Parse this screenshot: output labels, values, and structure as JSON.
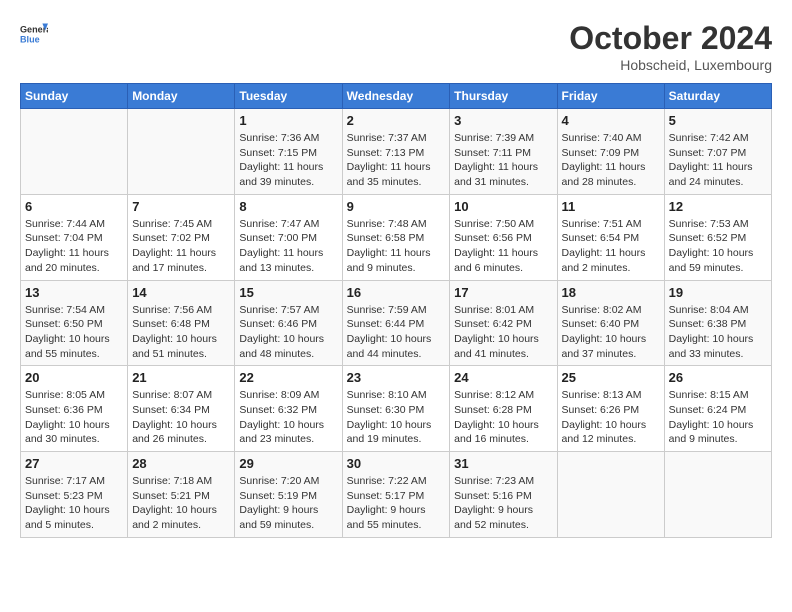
{
  "header": {
    "logo_general": "General",
    "logo_blue": "Blue",
    "month_title": "October 2024",
    "location": "Hobscheid, Luxembourg"
  },
  "days_of_week": [
    "Sunday",
    "Monday",
    "Tuesday",
    "Wednesday",
    "Thursday",
    "Friday",
    "Saturday"
  ],
  "weeks": [
    [
      {
        "day": "",
        "info": ""
      },
      {
        "day": "",
        "info": ""
      },
      {
        "day": "1",
        "info": "Sunrise: 7:36 AM\nSunset: 7:15 PM\nDaylight: 11 hours\nand 39 minutes."
      },
      {
        "day": "2",
        "info": "Sunrise: 7:37 AM\nSunset: 7:13 PM\nDaylight: 11 hours\nand 35 minutes."
      },
      {
        "day": "3",
        "info": "Sunrise: 7:39 AM\nSunset: 7:11 PM\nDaylight: 11 hours\nand 31 minutes."
      },
      {
        "day": "4",
        "info": "Sunrise: 7:40 AM\nSunset: 7:09 PM\nDaylight: 11 hours\nand 28 minutes."
      },
      {
        "day": "5",
        "info": "Sunrise: 7:42 AM\nSunset: 7:07 PM\nDaylight: 11 hours\nand 24 minutes."
      }
    ],
    [
      {
        "day": "6",
        "info": "Sunrise: 7:44 AM\nSunset: 7:04 PM\nDaylight: 11 hours\nand 20 minutes."
      },
      {
        "day": "7",
        "info": "Sunrise: 7:45 AM\nSunset: 7:02 PM\nDaylight: 11 hours\nand 17 minutes."
      },
      {
        "day": "8",
        "info": "Sunrise: 7:47 AM\nSunset: 7:00 PM\nDaylight: 11 hours\nand 13 minutes."
      },
      {
        "day": "9",
        "info": "Sunrise: 7:48 AM\nSunset: 6:58 PM\nDaylight: 11 hours\nand 9 minutes."
      },
      {
        "day": "10",
        "info": "Sunrise: 7:50 AM\nSunset: 6:56 PM\nDaylight: 11 hours\nand 6 minutes."
      },
      {
        "day": "11",
        "info": "Sunrise: 7:51 AM\nSunset: 6:54 PM\nDaylight: 11 hours\nand 2 minutes."
      },
      {
        "day": "12",
        "info": "Sunrise: 7:53 AM\nSunset: 6:52 PM\nDaylight: 10 hours\nand 59 minutes."
      }
    ],
    [
      {
        "day": "13",
        "info": "Sunrise: 7:54 AM\nSunset: 6:50 PM\nDaylight: 10 hours\nand 55 minutes."
      },
      {
        "day": "14",
        "info": "Sunrise: 7:56 AM\nSunset: 6:48 PM\nDaylight: 10 hours\nand 51 minutes."
      },
      {
        "day": "15",
        "info": "Sunrise: 7:57 AM\nSunset: 6:46 PM\nDaylight: 10 hours\nand 48 minutes."
      },
      {
        "day": "16",
        "info": "Sunrise: 7:59 AM\nSunset: 6:44 PM\nDaylight: 10 hours\nand 44 minutes."
      },
      {
        "day": "17",
        "info": "Sunrise: 8:01 AM\nSunset: 6:42 PM\nDaylight: 10 hours\nand 41 minutes."
      },
      {
        "day": "18",
        "info": "Sunrise: 8:02 AM\nSunset: 6:40 PM\nDaylight: 10 hours\nand 37 minutes."
      },
      {
        "day": "19",
        "info": "Sunrise: 8:04 AM\nSunset: 6:38 PM\nDaylight: 10 hours\nand 33 minutes."
      }
    ],
    [
      {
        "day": "20",
        "info": "Sunrise: 8:05 AM\nSunset: 6:36 PM\nDaylight: 10 hours\nand 30 minutes."
      },
      {
        "day": "21",
        "info": "Sunrise: 8:07 AM\nSunset: 6:34 PM\nDaylight: 10 hours\nand 26 minutes."
      },
      {
        "day": "22",
        "info": "Sunrise: 8:09 AM\nSunset: 6:32 PM\nDaylight: 10 hours\nand 23 minutes."
      },
      {
        "day": "23",
        "info": "Sunrise: 8:10 AM\nSunset: 6:30 PM\nDaylight: 10 hours\nand 19 minutes."
      },
      {
        "day": "24",
        "info": "Sunrise: 8:12 AM\nSunset: 6:28 PM\nDaylight: 10 hours\nand 16 minutes."
      },
      {
        "day": "25",
        "info": "Sunrise: 8:13 AM\nSunset: 6:26 PM\nDaylight: 10 hours\nand 12 minutes."
      },
      {
        "day": "26",
        "info": "Sunrise: 8:15 AM\nSunset: 6:24 PM\nDaylight: 10 hours\nand 9 minutes."
      }
    ],
    [
      {
        "day": "27",
        "info": "Sunrise: 7:17 AM\nSunset: 5:23 PM\nDaylight: 10 hours\nand 5 minutes."
      },
      {
        "day": "28",
        "info": "Sunrise: 7:18 AM\nSunset: 5:21 PM\nDaylight: 10 hours\nand 2 minutes."
      },
      {
        "day": "29",
        "info": "Sunrise: 7:20 AM\nSunset: 5:19 PM\nDaylight: 9 hours\nand 59 minutes."
      },
      {
        "day": "30",
        "info": "Sunrise: 7:22 AM\nSunset: 5:17 PM\nDaylight: 9 hours\nand 55 minutes."
      },
      {
        "day": "31",
        "info": "Sunrise: 7:23 AM\nSunset: 5:16 PM\nDaylight: 9 hours\nand 52 minutes."
      },
      {
        "day": "",
        "info": ""
      },
      {
        "day": "",
        "info": ""
      }
    ]
  ]
}
